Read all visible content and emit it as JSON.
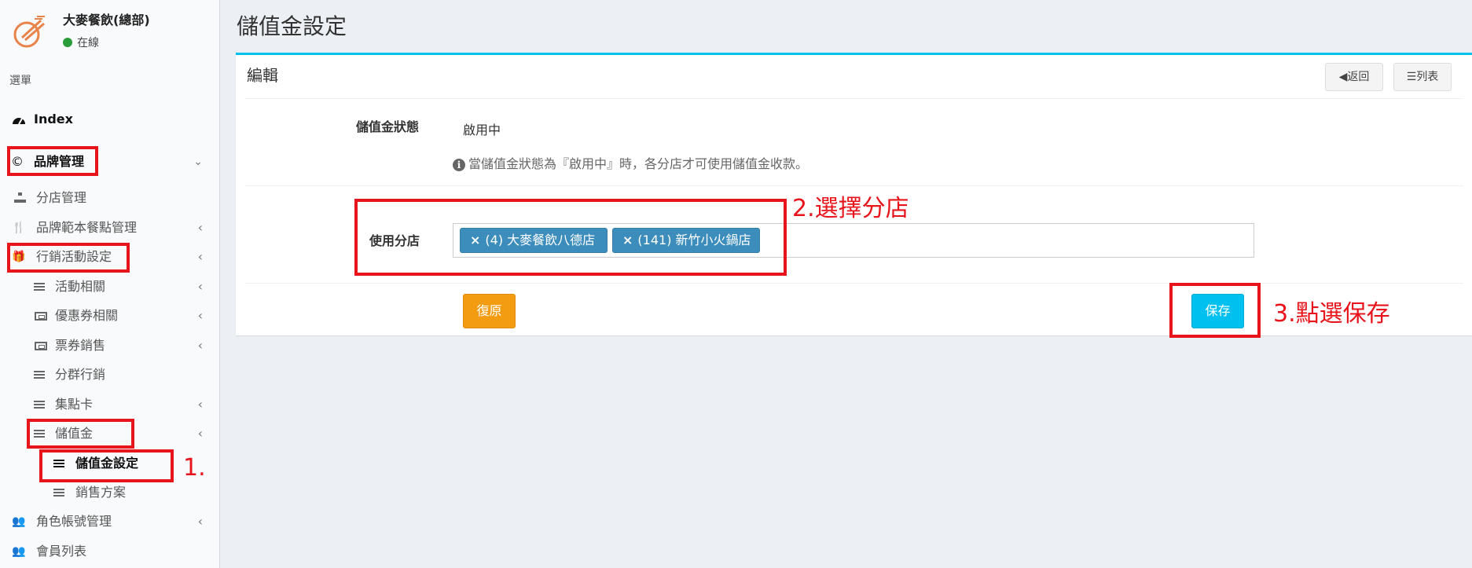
{
  "sidebar": {
    "brand_name": "大麥餐飲(總部)",
    "status": "在線",
    "menu_header": "選單",
    "items": {
      "index": "Index",
      "brand_mgmt": "品牌管理",
      "store_mgmt": "分店管理",
      "menu_template": "品牌範本餐點管理",
      "marketing": "行銷活動設定",
      "activity": "活動相關",
      "coupon": "優惠券相關",
      "ticket_sales": "票券銷售",
      "segment": "分群行銷",
      "stamp_card": "集點卡",
      "stored_value": "儲值金",
      "stored_value_settings": "儲值金設定",
      "sales_plan": "銷售方案",
      "roles": "角色帳號管理",
      "members": "會員列表"
    }
  },
  "page": {
    "title": "儲值金設定"
  },
  "box": {
    "title": "編輯",
    "back_label": "返回",
    "list_label": "列表"
  },
  "form": {
    "status_label": "儲值金狀態",
    "status_value": "啟用中",
    "status_help": "當儲值金狀態為『啟用中』時，各分店才可使用儲值金收款。",
    "stores_label": "使用分店",
    "stores": [
      "(4) 大麥餐飲八德店",
      "(141) 新竹小火鍋店"
    ],
    "restore_label": "復原",
    "save_label": "保存"
  },
  "annotations": {
    "step1": "1.",
    "step2": "2.選擇分店",
    "step3": "3.點選保存"
  },
  "colors": {
    "annotation_red": "#e8141b",
    "tag_blue": "#3c8dbc",
    "save_cyan": "#00c0ef",
    "restore_orange": "#f39c12",
    "logo_orange": "#e8834a"
  }
}
